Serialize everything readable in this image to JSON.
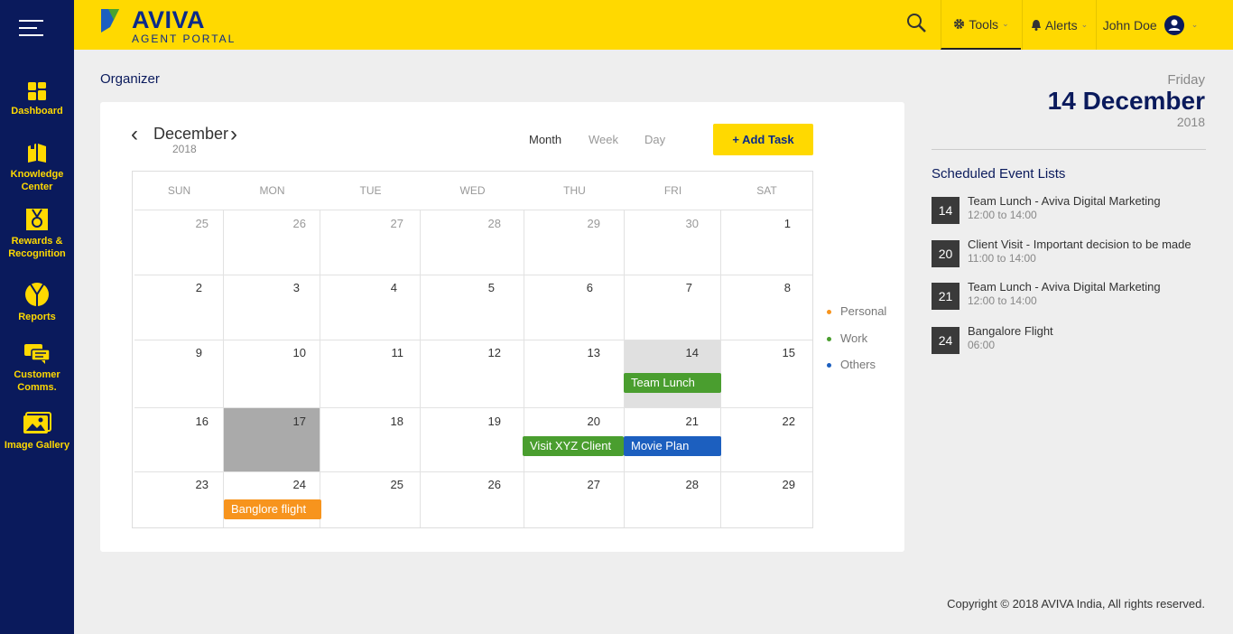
{
  "sidebar": {
    "items": [
      {
        "label": "Dashboard",
        "icon": "dashboard-icon"
      },
      {
        "label": "Knowledge Center",
        "icon": "book-icon"
      },
      {
        "label": "Rewards & Recognition",
        "icon": "medal-icon"
      },
      {
        "label": "Reports",
        "icon": "pie-chart-icon"
      },
      {
        "label": "Customer Comms.",
        "icon": "chat-icon"
      },
      {
        "label": "Image Gallery",
        "icon": "image-icon"
      }
    ]
  },
  "header": {
    "brand": "AVIVA",
    "brand_sub": "AGENT PORTAL",
    "tools_label": "Tools",
    "alerts_label": "Alerts",
    "user_name": "John Doe"
  },
  "page": {
    "title": "Organizer"
  },
  "calendar": {
    "month": "December",
    "year": "2018",
    "views": [
      "Month",
      "Week",
      "Day"
    ],
    "active_view": "Month",
    "add_task_label": "+ Add Task",
    "weekdays": [
      "SUN",
      "MON",
      "TUE",
      "WED",
      "THU",
      "FRI",
      "SAT"
    ],
    "weeks": [
      [
        "25",
        "26",
        "27",
        "28",
        "29",
        "30",
        "1"
      ],
      [
        "2",
        "3",
        "4",
        "5",
        "6",
        "7",
        "8"
      ],
      [
        "9",
        "10",
        "11",
        "12",
        "13",
        "14",
        "15"
      ],
      [
        "16",
        "17",
        "18",
        "19",
        "20",
        "21",
        "22"
      ],
      [
        "23",
        "24",
        "25",
        "26",
        "27",
        "28",
        "29"
      ]
    ],
    "events": [
      {
        "label": "Team Lunch",
        "category": "Work"
      },
      {
        "label": "Visit XYZ Client",
        "category": "Work"
      },
      {
        "label": "Movie Plan",
        "category": "Others"
      },
      {
        "label": "Banglore flight",
        "category": "Personal"
      }
    ]
  },
  "legend": [
    {
      "label": "Personal",
      "color": "#f7941d"
    },
    {
      "label": "Work",
      "color": "#4a9e2f"
    },
    {
      "label": "Others",
      "color": "#1c5fbf"
    }
  ],
  "selected_date": {
    "weekday": "Friday",
    "day_month": "14 December",
    "year": "2018"
  },
  "schedule": {
    "title": "Scheduled Event Lists",
    "items": [
      {
        "day": "14",
        "name": "Team Lunch - Aviva Digital Marketing",
        "time": "12:00  to 14:00"
      },
      {
        "day": "20",
        "name": "Client Visit - Important decision to be made",
        "time": "11:00  to 14:00"
      },
      {
        "day": "21",
        "name": "Team Lunch - Aviva Digital Marketing",
        "time": "12:00  to 14:00"
      },
      {
        "day": "24",
        "name": "Bangalore Flight",
        "time": "06:00"
      }
    ]
  },
  "footer": {
    "copyright": "Copyright  © 2018 AVIVA India, All rights reserved."
  }
}
